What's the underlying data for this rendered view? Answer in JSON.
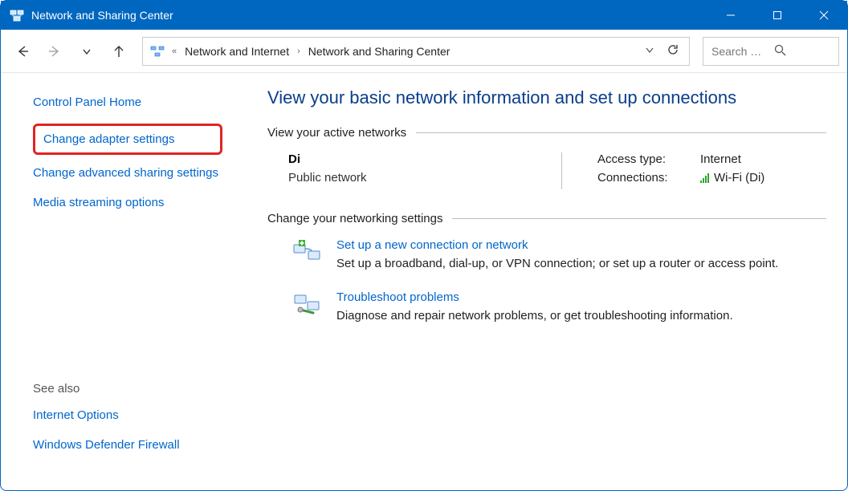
{
  "window": {
    "title": "Network and Sharing Center"
  },
  "breadcrumb": {
    "item1": "Network and Internet",
    "item2": "Network and Sharing Center"
  },
  "search": {
    "placeholder": "Search C..."
  },
  "sidebar": {
    "home": "Control Panel Home",
    "adapter": "Change adapter settings",
    "advanced": "Change advanced sharing settings",
    "media": "Media streaming options",
    "seealso_label": "See also",
    "internet_options": "Internet Options",
    "firewall": "Windows Defender Firewall"
  },
  "main": {
    "heading": "View your basic network information and set up connections",
    "active_header": "View your active networks",
    "network": {
      "name": "Di",
      "type": "Public network",
      "access_label": "Access type:",
      "access_value": "Internet",
      "conn_label": "Connections:",
      "conn_value": "Wi-Fi (Di)"
    },
    "change_header": "Change your networking settings",
    "setup": {
      "title": "Set up a new connection or network",
      "desc": "Set up a broadband, dial-up, or VPN connection; or set up a router or access point."
    },
    "troubleshoot": {
      "title": "Troubleshoot problems",
      "desc": "Diagnose and repair network problems, or get troubleshooting information."
    }
  }
}
